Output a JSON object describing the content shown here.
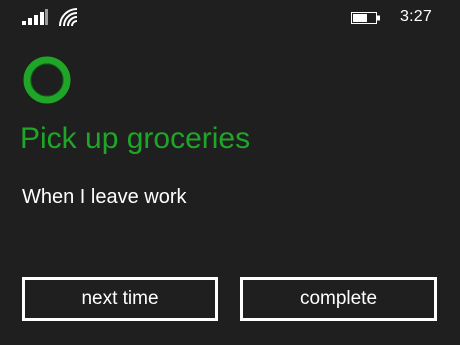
{
  "status_bar": {
    "time": "3:27",
    "icons": [
      "signal-strength-icon",
      "wifi-icon",
      "battery-icon"
    ]
  },
  "reminder": {
    "assistant_icon": "cortana-ring-icon",
    "title": "Pick up groceries",
    "condition": "When I leave work"
  },
  "actions": {
    "next_time_label": "next time",
    "complete_label": "complete"
  },
  "colors": {
    "background": "#1f1f1f",
    "accent_green": "#1fa628",
    "text": "#ffffff"
  }
}
